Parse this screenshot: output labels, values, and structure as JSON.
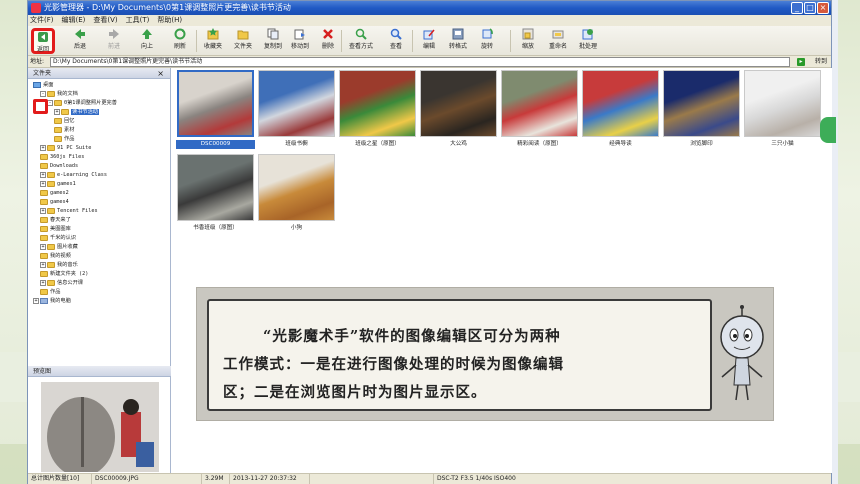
{
  "app": {
    "title": "光影管理器 - D:\\My Documents\\0第1课调整照片更完善\\读书节活动",
    "window_controls": [
      "_",
      "□",
      "×"
    ]
  },
  "menu": [
    "文件(F)",
    "编辑(E)",
    "查看(V)",
    "工具(T)",
    "帮助(H)"
  ],
  "toolbar": {
    "back": "返回",
    "forward": "后退",
    "next": "前进",
    "up": "向上",
    "refresh": "刷新",
    "favorites": "收藏夹",
    "folder": "文件夹",
    "copy_to": "复制到",
    "move_to": "移动到",
    "delete": "删除",
    "view_mode": "查看方式",
    "view": "查看",
    "edit": "编辑",
    "convert": "转格式",
    "rotate": "旋转",
    "zoom": "缩放",
    "rename": "重命名",
    "batch": "批处理"
  },
  "address": {
    "label": "地址:",
    "value": "D:\\My Documents\\0第1课调整照片更完善\\读书节活动",
    "go": "转到"
  },
  "folders_pane": {
    "title": "文件夹",
    "close": "×",
    "tree": [
      {
        "label": "桌面",
        "toggle": "",
        "icon": "desk"
      },
      {
        "label": "我的文档",
        "toggle": "-",
        "icon": "folder"
      },
      {
        "label": "0第1课调整照片更完善",
        "toggle": "-",
        "icon": "folder"
      },
      {
        "label": "读书节活动",
        "toggle": "+",
        "icon": "folder",
        "selected": true
      },
      {
        "label": "回忆",
        "toggle": "",
        "icon": "folder"
      },
      {
        "label": "素材",
        "toggle": "",
        "icon": "folder"
      },
      {
        "label": "作品",
        "toggle": "",
        "icon": "folder"
      },
      {
        "label": "91 PC Suite",
        "toggle": "+",
        "icon": "folder"
      },
      {
        "label": "360js Files",
        "toggle": "",
        "icon": "folder"
      },
      {
        "label": "Downloads",
        "toggle": "",
        "icon": "folder"
      },
      {
        "label": "e-Learning Class",
        "toggle": "+",
        "icon": "folder"
      },
      {
        "label": "games1",
        "toggle": "+",
        "icon": "folder"
      },
      {
        "label": "games2",
        "toggle": "",
        "icon": "folder"
      },
      {
        "label": "games4",
        "toggle": "",
        "icon": "folder"
      },
      {
        "label": "Tencent Files",
        "toggle": "+",
        "icon": "folder"
      },
      {
        "label": "春天来了",
        "toggle": "",
        "icon": "folder"
      },
      {
        "label": "美图图库",
        "toggle": "",
        "icon": "folder"
      },
      {
        "label": "千米的认识",
        "toggle": "",
        "icon": "folder"
      },
      {
        "label": "图片收藏",
        "toggle": "+",
        "icon": "folder"
      },
      {
        "label": "我的视频",
        "toggle": "",
        "icon": "folder"
      },
      {
        "label": "我的音乐",
        "toggle": "+",
        "icon": "folder"
      },
      {
        "label": "新建文件夹 (2)",
        "toggle": "",
        "icon": "folder"
      },
      {
        "label": "信息公开课",
        "toggle": "+",
        "icon": "folder"
      },
      {
        "label": "作品",
        "toggle": "",
        "icon": "folder"
      },
      {
        "label": "我的电脑",
        "toggle": "+",
        "icon": "pc"
      }
    ]
  },
  "preview_pane": {
    "title": "预览图"
  },
  "thumbnails": [
    {
      "caption": "DSC00009",
      "selected": true,
      "colors": [
        "#d8d3cc",
        "#8a8480",
        "#b33a3a"
      ]
    },
    {
      "caption": "班级书橱",
      "colors": [
        "#3f6fb8",
        "#d1d6de",
        "#9a3a3a"
      ]
    },
    {
      "caption": "班级之星（原图）",
      "colors": [
        "#9b3b2c",
        "#3a8a3a",
        "#f0c848"
      ]
    },
    {
      "caption": "大公鸡",
      "colors": [
        "#3a3530",
        "#6b4a2c",
        "#2a2520"
      ]
    },
    {
      "caption": "精彩阅读（原图）",
      "colors": [
        "#7f8b6f",
        "#c83a3a",
        "#e8e4dc"
      ]
    },
    {
      "caption": "经典导读",
      "colors": [
        "#c73b3b",
        "#3a7ac8",
        "#e8d048"
      ]
    },
    {
      "caption": "浏览脚印",
      "colors": [
        "#1a2b6b",
        "#9a7a4a",
        "#3a4a8a"
      ]
    },
    {
      "caption": "三只小猫",
      "colors": [
        "#f0f0f0",
        "#d8d8d8",
        "#b8b0a8"
      ]
    },
    {
      "caption": "书香班级（原图）",
      "colors": [
        "#6a7270",
        "#3a3a3a",
        "#a8a8a0"
      ]
    },
    {
      "caption": "小狗",
      "colors": [
        "#e7e2d8",
        "#c88a3a",
        "#a86428"
      ]
    }
  ],
  "status": {
    "count": "总计图片数量[10]",
    "file": "DSC00009.JPG",
    "size": "3.29M",
    "date": "2013-11-27 20:37:32",
    "exif": "DSC-T2 F3.5 1/40s ISO400"
  },
  "note": {
    "line1": "“光影魔术手”软件的图像编辑区可分为两种",
    "line2": "工作模式：一是在进行图像处理的时候为图像编辑",
    "line3": "区；二是在浏览图片时为图片显示区。"
  }
}
